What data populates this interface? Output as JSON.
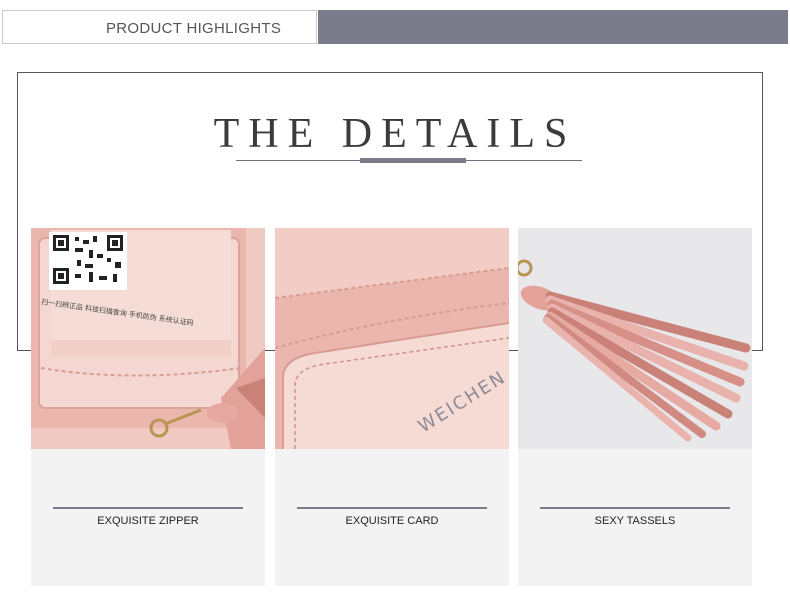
{
  "header": {
    "label": "PRODUCT HIGHLIGHTS"
  },
  "details": {
    "title": "THE DETAILS"
  },
  "cards": [
    {
      "caption": "EXQUISITE ZIPPER",
      "image_text": "扫一扫辨正品 科技扫描查询 手机防伪 系统认证码"
    },
    {
      "caption": "EXQUISITE CARD",
      "image_text": "WEICHEN"
    },
    {
      "caption": "SEXY TASSELS"
    }
  ],
  "colors": {
    "accent": "#7c7b8c",
    "leather": "#e9b2ad",
    "card_bg": "#f3f3f4"
  }
}
